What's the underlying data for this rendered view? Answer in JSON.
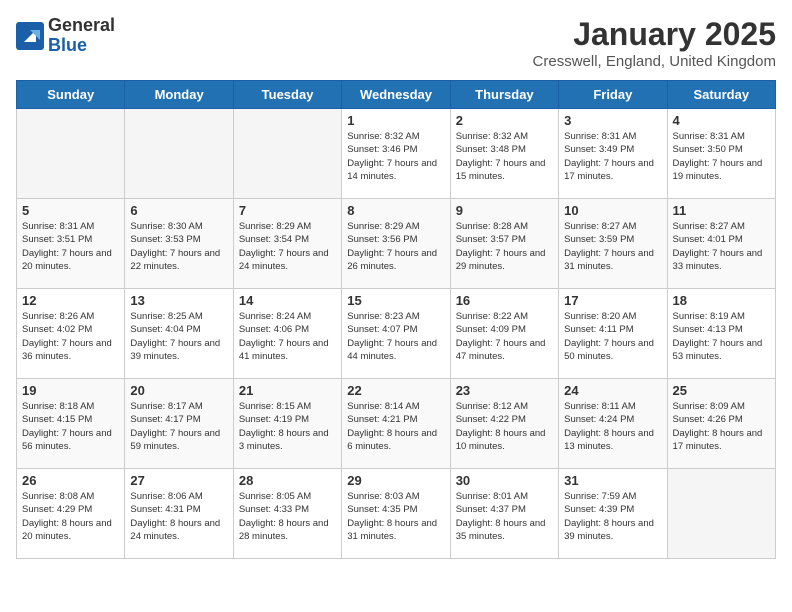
{
  "header": {
    "logo_general": "General",
    "logo_blue": "Blue",
    "month_title": "January 2025",
    "location": "Cresswell, England, United Kingdom"
  },
  "weekdays": [
    "Sunday",
    "Monday",
    "Tuesday",
    "Wednesday",
    "Thursday",
    "Friday",
    "Saturday"
  ],
  "weeks": [
    [
      {
        "day": "",
        "empty": true
      },
      {
        "day": "",
        "empty": true
      },
      {
        "day": "",
        "empty": true
      },
      {
        "day": "1",
        "sunrise": "8:32 AM",
        "sunset": "3:46 PM",
        "daylight": "7 hours and 14 minutes."
      },
      {
        "day": "2",
        "sunrise": "8:32 AM",
        "sunset": "3:48 PM",
        "daylight": "7 hours and 15 minutes."
      },
      {
        "day": "3",
        "sunrise": "8:31 AM",
        "sunset": "3:49 PM",
        "daylight": "7 hours and 17 minutes."
      },
      {
        "day": "4",
        "sunrise": "8:31 AM",
        "sunset": "3:50 PM",
        "daylight": "7 hours and 19 minutes."
      }
    ],
    [
      {
        "day": "5",
        "sunrise": "8:31 AM",
        "sunset": "3:51 PM",
        "daylight": "7 hours and 20 minutes."
      },
      {
        "day": "6",
        "sunrise": "8:30 AM",
        "sunset": "3:53 PM",
        "daylight": "7 hours and 22 minutes."
      },
      {
        "day": "7",
        "sunrise": "8:29 AM",
        "sunset": "3:54 PM",
        "daylight": "7 hours and 24 minutes."
      },
      {
        "day": "8",
        "sunrise": "8:29 AM",
        "sunset": "3:56 PM",
        "daylight": "7 hours and 26 minutes."
      },
      {
        "day": "9",
        "sunrise": "8:28 AM",
        "sunset": "3:57 PM",
        "daylight": "7 hours and 29 minutes."
      },
      {
        "day": "10",
        "sunrise": "8:27 AM",
        "sunset": "3:59 PM",
        "daylight": "7 hours and 31 minutes."
      },
      {
        "day": "11",
        "sunrise": "8:27 AM",
        "sunset": "4:01 PM",
        "daylight": "7 hours and 33 minutes."
      }
    ],
    [
      {
        "day": "12",
        "sunrise": "8:26 AM",
        "sunset": "4:02 PM",
        "daylight": "7 hours and 36 minutes."
      },
      {
        "day": "13",
        "sunrise": "8:25 AM",
        "sunset": "4:04 PM",
        "daylight": "7 hours and 39 minutes."
      },
      {
        "day": "14",
        "sunrise": "8:24 AM",
        "sunset": "4:06 PM",
        "daylight": "7 hours and 41 minutes."
      },
      {
        "day": "15",
        "sunrise": "8:23 AM",
        "sunset": "4:07 PM",
        "daylight": "7 hours and 44 minutes."
      },
      {
        "day": "16",
        "sunrise": "8:22 AM",
        "sunset": "4:09 PM",
        "daylight": "7 hours and 47 minutes."
      },
      {
        "day": "17",
        "sunrise": "8:20 AM",
        "sunset": "4:11 PM",
        "daylight": "7 hours and 50 minutes."
      },
      {
        "day": "18",
        "sunrise": "8:19 AM",
        "sunset": "4:13 PM",
        "daylight": "7 hours and 53 minutes."
      }
    ],
    [
      {
        "day": "19",
        "sunrise": "8:18 AM",
        "sunset": "4:15 PM",
        "daylight": "7 hours and 56 minutes."
      },
      {
        "day": "20",
        "sunrise": "8:17 AM",
        "sunset": "4:17 PM",
        "daylight": "7 hours and 59 minutes."
      },
      {
        "day": "21",
        "sunrise": "8:15 AM",
        "sunset": "4:19 PM",
        "daylight": "8 hours and 3 minutes."
      },
      {
        "day": "22",
        "sunrise": "8:14 AM",
        "sunset": "4:21 PM",
        "daylight": "8 hours and 6 minutes."
      },
      {
        "day": "23",
        "sunrise": "8:12 AM",
        "sunset": "4:22 PM",
        "daylight": "8 hours and 10 minutes."
      },
      {
        "day": "24",
        "sunrise": "8:11 AM",
        "sunset": "4:24 PM",
        "daylight": "8 hours and 13 minutes."
      },
      {
        "day": "25",
        "sunrise": "8:09 AM",
        "sunset": "4:26 PM",
        "daylight": "8 hours and 17 minutes."
      }
    ],
    [
      {
        "day": "26",
        "sunrise": "8:08 AM",
        "sunset": "4:29 PM",
        "daylight": "8 hours and 20 minutes."
      },
      {
        "day": "27",
        "sunrise": "8:06 AM",
        "sunset": "4:31 PM",
        "daylight": "8 hours and 24 minutes."
      },
      {
        "day": "28",
        "sunrise": "8:05 AM",
        "sunset": "4:33 PM",
        "daylight": "8 hours and 28 minutes."
      },
      {
        "day": "29",
        "sunrise": "8:03 AM",
        "sunset": "4:35 PM",
        "daylight": "8 hours and 31 minutes."
      },
      {
        "day": "30",
        "sunrise": "8:01 AM",
        "sunset": "4:37 PM",
        "daylight": "8 hours and 35 minutes."
      },
      {
        "day": "31",
        "sunrise": "7:59 AM",
        "sunset": "4:39 PM",
        "daylight": "8 hours and 39 minutes."
      },
      {
        "day": "",
        "empty": true
      }
    ]
  ]
}
